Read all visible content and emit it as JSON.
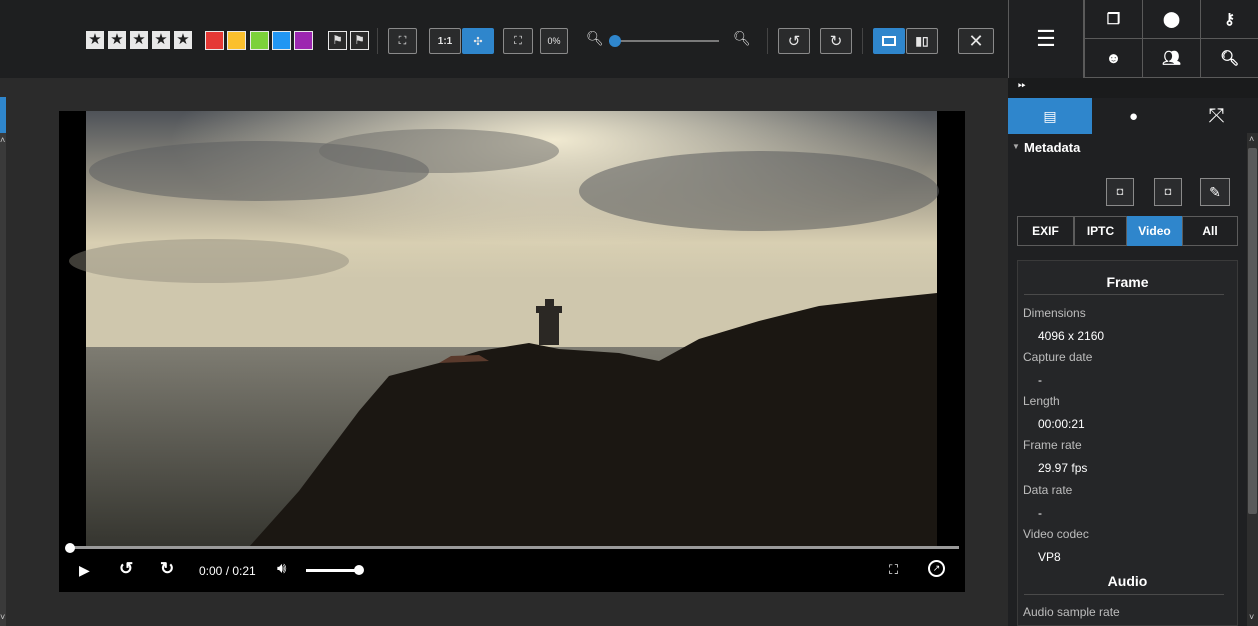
{
  "toolbar": {
    "ratio_label": "1:1",
    "zoom_value": "0%",
    "rating_icons": [
      "star-icon",
      "star-icon",
      "star-icon",
      "star-icon",
      "star-icon"
    ],
    "color_labels": [
      "#e53935",
      "#fbc02d",
      "#7cd13a",
      "#2196f3",
      "#9c27b0"
    ],
    "zoom_fraction": 0.0
  },
  "right_panel": {
    "section_title": "Metadata",
    "tabs": [
      "EXIF",
      "IPTC",
      "Video",
      "All"
    ],
    "active_tab": "Video",
    "frame_heading": "Frame",
    "audio_heading": "Audio",
    "fields": [
      {
        "label": "Dimensions",
        "value": "4096 x 2160"
      },
      {
        "label": "Capture date",
        "value": "-"
      },
      {
        "label": "Length",
        "value": "00:00:21"
      },
      {
        "label": "Frame rate",
        "value": "29.97 fps"
      },
      {
        "label": "Data rate",
        "value": "-"
      },
      {
        "label": "Video codec",
        "value": "VP8"
      }
    ],
    "audio_fields": [
      {
        "label": "Audio sample rate"
      }
    ]
  },
  "player": {
    "time": "0:00 / 0:21",
    "progress": 0.0,
    "volume": 1.0
  },
  "colors": {
    "accent": "#2f86cc",
    "panel_bg": "#1f2022",
    "toolbar_bg": "#1e1f20"
  }
}
